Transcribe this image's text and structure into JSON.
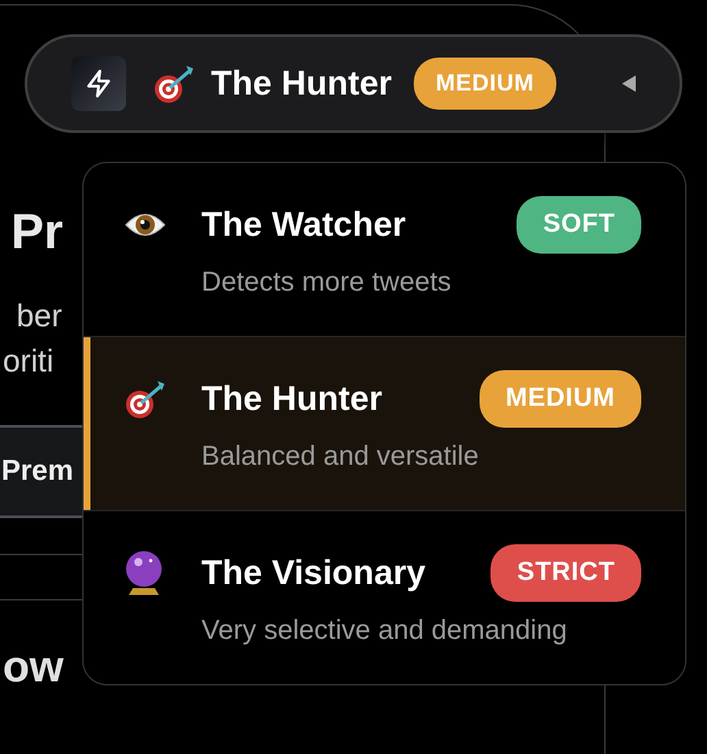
{
  "background": {
    "heading": "Pr",
    "text_lines": [
      "ber",
      "oriti"
    ],
    "button": "Prem",
    "subheading": "ow"
  },
  "selector": {
    "kind": "target",
    "label": "The Hunter",
    "badge": "MEDIUM",
    "color": "#e8a23a"
  },
  "options": [
    {
      "kind": "eye",
      "name": "The Watcher",
      "description": "Detects more tweets",
      "badge": "SOFT",
      "color": "#4fb582",
      "selected": false
    },
    {
      "kind": "target",
      "name": "The Hunter",
      "description": "Balanced and versatile",
      "badge": "MEDIUM",
      "color": "#e8a23a",
      "selected": true
    },
    {
      "kind": "crystal-ball",
      "name": "The Visionary",
      "description": "Very selective and demanding",
      "badge": "STRICT",
      "color": "#de4f4c",
      "selected": false
    }
  ]
}
